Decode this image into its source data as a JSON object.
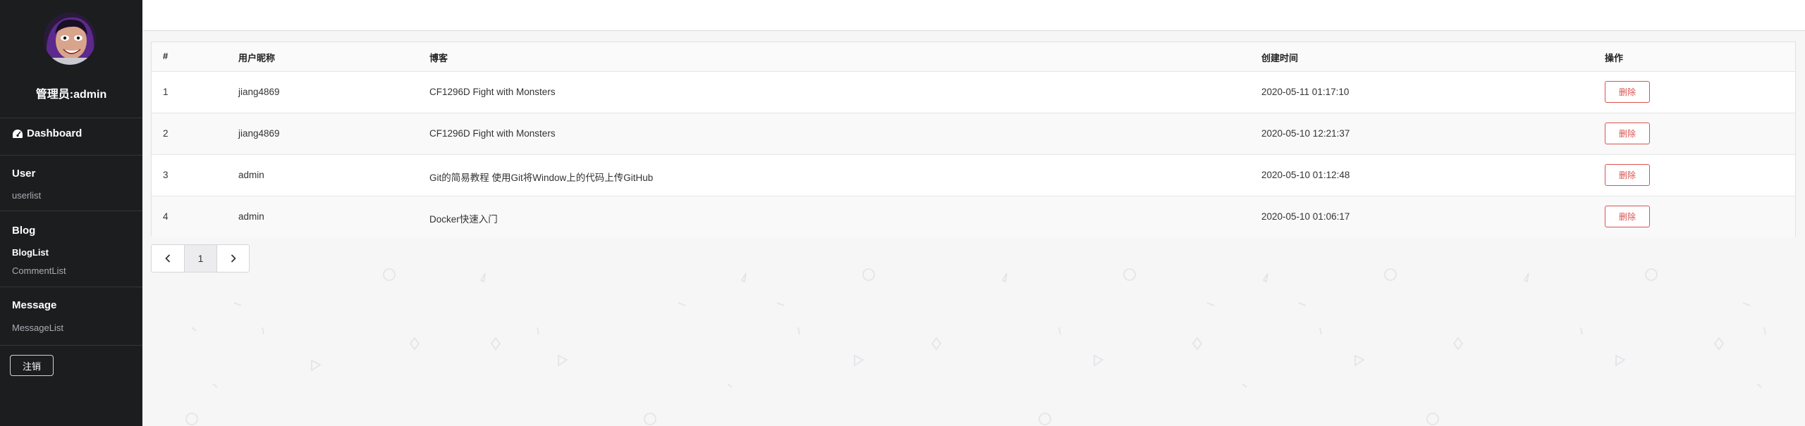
{
  "sidebar": {
    "admin_name": "管理员:admin",
    "dashboard_label": "Dashboard",
    "sections": [
      {
        "title": "User",
        "links": [
          {
            "label": "userlist",
            "active": false
          }
        ]
      },
      {
        "title": "Blog",
        "links": [
          {
            "label": "BlogList",
            "active": true
          },
          {
            "label": "CommentList",
            "active": false
          }
        ]
      },
      {
        "title": "Message",
        "links": [
          {
            "label": "MessageList",
            "active": false
          }
        ]
      }
    ],
    "logout_label": "注销"
  },
  "table": {
    "headers": [
      "#",
      "用户昵称",
      "博客",
      "创建时间",
      "操作"
    ],
    "rows": [
      {
        "id": "1",
        "user": "jiang4869",
        "blog": "CF1296D Fight with Monsters",
        "created": "2020-05-11 01:17:10",
        "action": "删除"
      },
      {
        "id": "2",
        "user": "jiang4869",
        "blog": "CF1296D Fight with Monsters",
        "created": "2020-05-10 12:21:37",
        "action": "删除"
      },
      {
        "id": "3",
        "user": "admin",
        "blog": "Git的简易教程 使用Git将Window上的代码上传GitHub",
        "created": "2020-05-10 01:12:48",
        "action": "删除"
      },
      {
        "id": "4",
        "user": "admin",
        "blog": "Docker快速入门",
        "created": "2020-05-10 01:06:17",
        "action": "删除"
      }
    ]
  },
  "pagination": {
    "prev_icon": "chevron-left-icon",
    "current_page": "1",
    "next_icon": "chevron-right-icon"
  },
  "colors": {
    "sidebar_bg": "#1c1d1f",
    "danger": "#d9534f",
    "page_bg": "#f6f6f7"
  }
}
